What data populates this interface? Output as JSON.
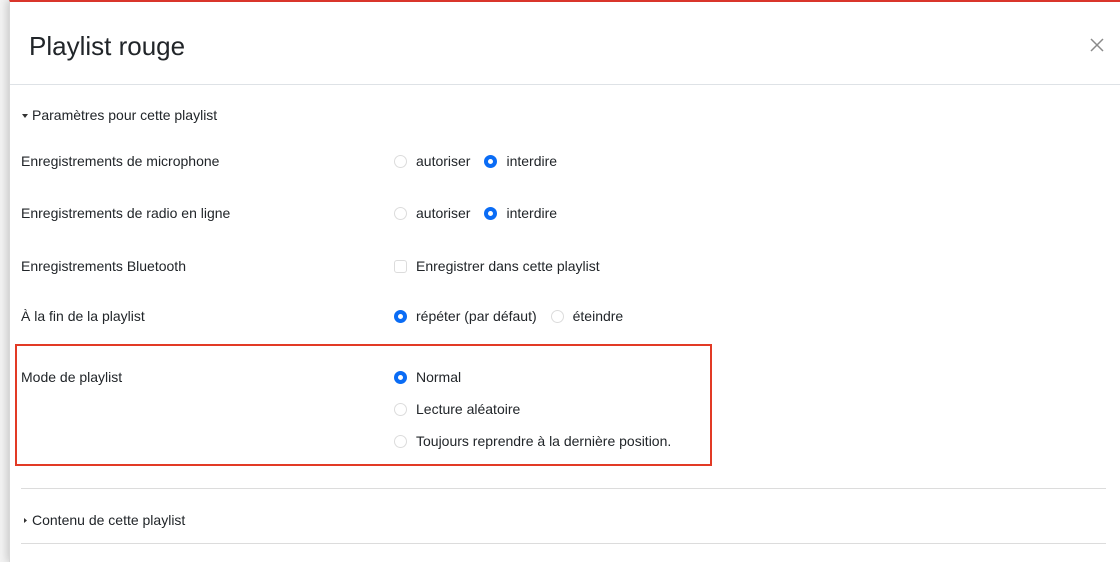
{
  "modal": {
    "title": "Playlist rouge",
    "close_icon": "close-icon"
  },
  "settings_section": {
    "label": "Paramètres pour cette playlist",
    "expanded": true,
    "rows": {
      "microphone": {
        "label": "Enregistrements de microphone",
        "options": [
          "autoriser",
          "interdire"
        ],
        "selected": "interdire"
      },
      "radio": {
        "label": "Enregistrements de radio en ligne",
        "options": [
          "autoriser",
          "interdire"
        ],
        "selected": "interdire"
      },
      "bluetooth": {
        "label": "Enregistrements Bluetooth",
        "checkbox_label": "Enregistrer dans cette playlist",
        "checked": false
      },
      "end": {
        "label": "À la fin de la playlist",
        "options": [
          "répéter (par défaut)",
          "éteindre"
        ],
        "selected": "répéter (par défaut)"
      },
      "mode": {
        "label": "Mode de playlist",
        "options": [
          "Normal",
          "Lecture aléatoire",
          "Toujours reprendre à la dernière position."
        ],
        "selected": "Normal",
        "highlighted": true
      }
    }
  },
  "content_section": {
    "label": "Contenu de cette playlist",
    "expanded": false
  },
  "colors": {
    "accent": "#0a6cf5",
    "highlight_border": "#e23a25",
    "top_border": "#d9352b"
  }
}
